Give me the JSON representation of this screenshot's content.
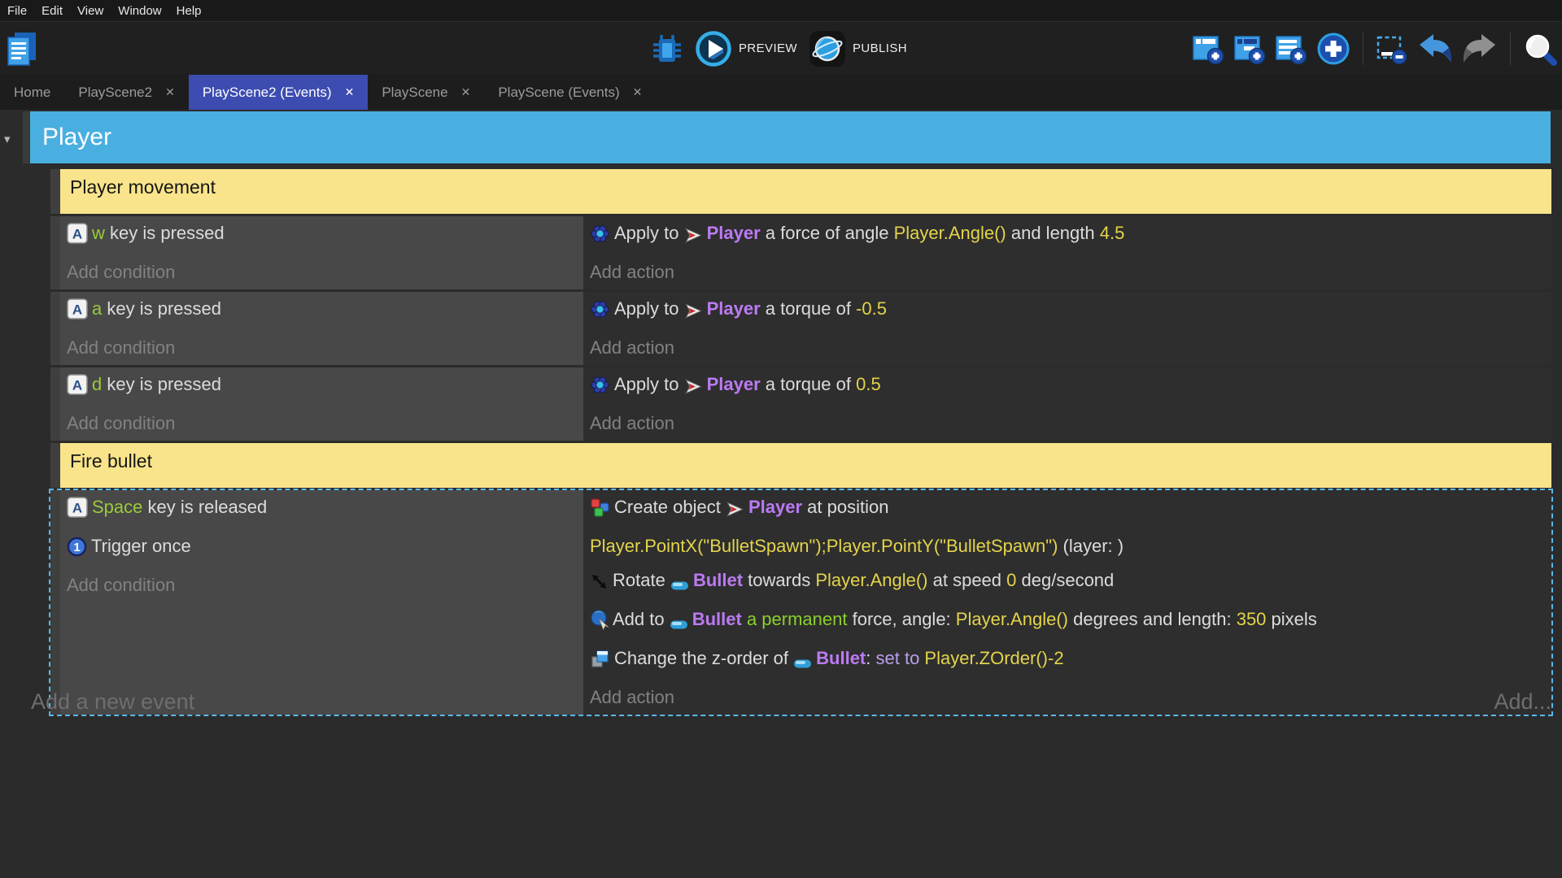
{
  "menu": {
    "items": [
      "File",
      "Edit",
      "View",
      "Window",
      "Help"
    ]
  },
  "toolbar": {
    "preview_label": "PREVIEW",
    "publish_label": "PUBLISH",
    "left_icons": [
      "project-manager"
    ],
    "center_icons": [
      "debug",
      "preview-play",
      "publish-globe"
    ],
    "right_icons": [
      "add-event",
      "add-subevent",
      "add-comment",
      "add-circle",
      "remove-event",
      "undo",
      "redo",
      "search"
    ]
  },
  "tabs": [
    {
      "label": "Home",
      "closable": false,
      "active": false
    },
    {
      "label": "PlayScene2",
      "closable": true,
      "active": false
    },
    {
      "label": "PlayScene2 (Events)",
      "closable": true,
      "active": true
    },
    {
      "label": "PlayScene",
      "closable": true,
      "active": false
    },
    {
      "label": "PlayScene (Events)",
      "closable": true,
      "active": false
    }
  ],
  "colors": {
    "accent_blue": "#49afe0",
    "comment_yellow": "#f9e48b",
    "active_tab_indigo": "#3c4cb1",
    "object_purple": "#bb7af2",
    "expression_yellow": "#e3d44b",
    "key_green": "#9aca3c",
    "selection_dash_blue": "#58b7e8"
  },
  "sheet": {
    "group_title": "Player",
    "add_condition_label": "Add condition",
    "add_action_label": "Add action",
    "add_new_event_label": "Add a new event",
    "add_more_label": "Add...",
    "rows": [
      {
        "type": "comment",
        "text": "Player movement"
      },
      {
        "type": "event",
        "conditions": [
          {
            "segments": [
              {
                "icon": "keyboard"
              },
              {
                "text": "w",
                "style": "key"
              },
              {
                "text": " key is pressed",
                "style": "plain"
              }
            ]
          }
        ],
        "actions": [
          {
            "segments": [
              {
                "icon": "physics"
              },
              {
                "text": "Apply to ",
                "style": "plain"
              },
              {
                "icon": "player-object"
              },
              {
                "text": "Player",
                "style": "object"
              },
              {
                "text": " a force of angle ",
                "style": "plain"
              },
              {
                "text": "Player.Angle()",
                "style": "expr"
              },
              {
                "text": " and length ",
                "style": "plain"
              },
              {
                "text": "4.5",
                "style": "expr"
              }
            ]
          }
        ]
      },
      {
        "type": "event",
        "conditions": [
          {
            "segments": [
              {
                "icon": "keyboard"
              },
              {
                "text": "a",
                "style": "key"
              },
              {
                "text": " key is pressed",
                "style": "plain"
              }
            ]
          }
        ],
        "actions": [
          {
            "segments": [
              {
                "icon": "physics"
              },
              {
                "text": "Apply to ",
                "style": "plain"
              },
              {
                "icon": "player-object"
              },
              {
                "text": "Player",
                "style": "object"
              },
              {
                "text": " a torque of ",
                "style": "plain"
              },
              {
                "text": "-0.5",
                "style": "expr"
              }
            ]
          }
        ]
      },
      {
        "type": "event",
        "conditions": [
          {
            "segments": [
              {
                "icon": "keyboard"
              },
              {
                "text": "d",
                "style": "key"
              },
              {
                "text": " key is pressed",
                "style": "plain"
              }
            ]
          }
        ],
        "actions": [
          {
            "segments": [
              {
                "icon": "physics"
              },
              {
                "text": "Apply to ",
                "style": "plain"
              },
              {
                "icon": "player-object"
              },
              {
                "text": "Player",
                "style": "object"
              },
              {
                "text": " a torque of ",
                "style": "plain"
              },
              {
                "text": "0.5",
                "style": "expr"
              }
            ]
          }
        ]
      },
      {
        "type": "comment",
        "text": "Fire bullet"
      },
      {
        "type": "event",
        "selected": true,
        "conditions": [
          {
            "segments": [
              {
                "icon": "keyboard"
              },
              {
                "text": "Space",
                "style": "key"
              },
              {
                "text": " key is released",
                "style": "plain"
              }
            ]
          },
          {
            "segments": [
              {
                "icon": "trigger-once"
              },
              {
                "text": "Trigger once",
                "style": "plain"
              }
            ]
          }
        ],
        "actions": [
          {
            "wrap": true,
            "segments": [
              {
                "icon": "create-object"
              },
              {
                "text": "Create object ",
                "style": "plain"
              },
              {
                "icon": "player-object"
              },
              {
                "text": "Player",
                "style": "object"
              },
              {
                "text": " at position ",
                "style": "plain"
              },
              {
                "text": "Player.PointX(\"BulletSpawn\");Player.PointY(\"BulletSpawn\")",
                "style": "expr"
              },
              {
                "text": " (layer: )",
                "style": "plain"
              }
            ]
          },
          {
            "segments": [
              {
                "icon": "rotate"
              },
              {
                "text": "Rotate ",
                "style": "plain"
              },
              {
                "icon": "bullet-object"
              },
              {
                "text": "Bullet",
                "style": "object"
              },
              {
                "text": " towards ",
                "style": "plain"
              },
              {
                "text": "Player.Angle()",
                "style": "expr"
              },
              {
                "text": " at speed ",
                "style": "plain"
              },
              {
                "text": "0",
                "style": "expr"
              },
              {
                "text": " deg/second",
                "style": "plain"
              }
            ]
          },
          {
            "segments": [
              {
                "icon": "force"
              },
              {
                "text": "Add to ",
                "style": "plain"
              },
              {
                "icon": "bullet-object"
              },
              {
                "text": "Bullet",
                "style": "object"
              },
              {
                "text": " a permanent",
                "style": "green"
              },
              {
                "text": " force, angle: ",
                "style": "plain"
              },
              {
                "text": "Player.Angle()",
                "style": "expr"
              },
              {
                "text": " degrees and length: ",
                "style": "plain"
              },
              {
                "text": "350",
                "style": "expr"
              },
              {
                "text": " pixels",
                "style": "plain"
              }
            ]
          },
          {
            "segments": [
              {
                "icon": "zorder"
              },
              {
                "text": "Change the z-order of ",
                "style": "plain"
              },
              {
                "icon": "bullet-object"
              },
              {
                "text": "Bullet",
                "style": "object"
              },
              {
                "text": ": ",
                "style": "plain"
              },
              {
                "text": "set to ",
                "style": "violet"
              },
              {
                "text": "Player.ZOrder()-2",
                "style": "expr"
              }
            ]
          }
        ]
      }
    ]
  }
}
